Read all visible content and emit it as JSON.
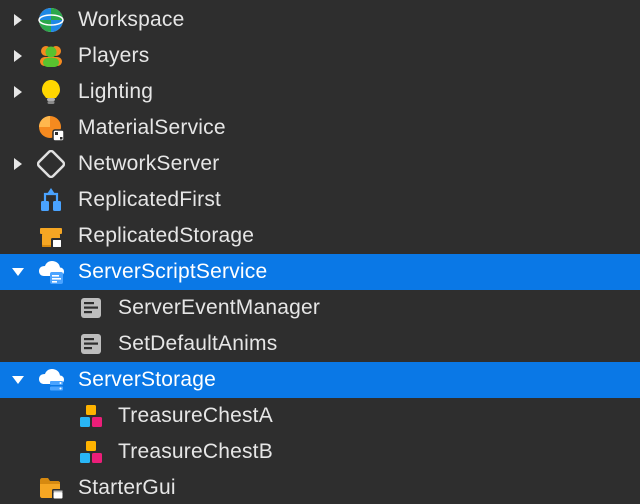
{
  "tree": {
    "workspace": "Workspace",
    "players": "Players",
    "lighting": "Lighting",
    "materialService": "MaterialService",
    "networkServer": "NetworkServer",
    "replicatedFirst": "ReplicatedFirst",
    "replicatedStorage": "ReplicatedStorage",
    "serverScriptService": "ServerScriptService",
    "serverEventManager": "ServerEventManager",
    "setDefaultAnims": "SetDefaultAnims",
    "serverStorage": "ServerStorage",
    "treasureChestA": "TreasureChestA",
    "treasureChestB": "TreasureChestB",
    "starterGui": "StarterGui"
  },
  "colors": {
    "selection": "#0a78e6",
    "bg": "#2e2e2e",
    "text": "#e6e6e6"
  }
}
